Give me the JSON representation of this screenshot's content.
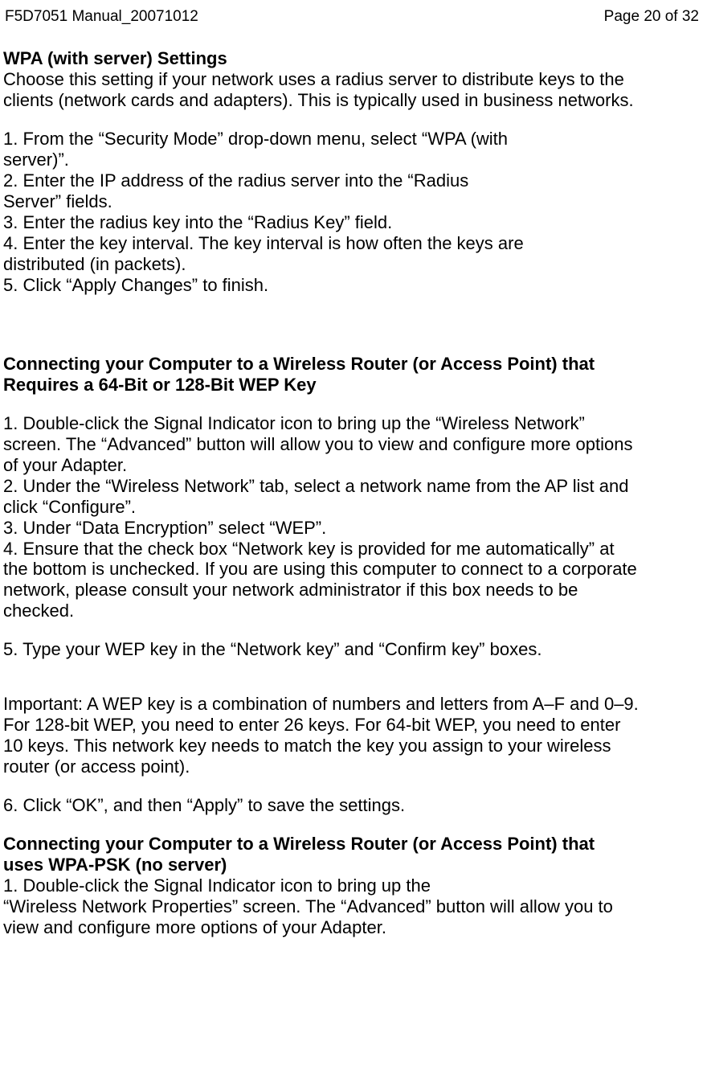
{
  "header": {
    "left": "F5D7051 Manual_20071012",
    "right": "Page 20 of 32"
  },
  "section1": {
    "title": "WPA (with server) Settings",
    "intro_l1": "Choose this setting if your network uses a radius server to distribute keys to the",
    "intro_l2": "clients (network cards and adapters). This is typically used in business networks.",
    "s1_l1": "1. From the “Security Mode” drop-down menu, select “WPA (with",
    "s1_l2": "server)”.",
    "s2_l1": "2. Enter the IP address of the radius server into the “Radius",
    "s2_l2": "Server” fields.",
    "s3": "3. Enter the radius key into the “Radius Key” field.",
    "s4_l1": "4. Enter the key interval. The key interval is how often the keys are",
    "s4_l2": "distributed (in packets).",
    "s5": "5. Click “Apply Changes” to finish."
  },
  "section2": {
    "title_l1": "Connecting your Computer to a Wireless Router (or Access Point) that",
    "title_l2": "Requires a 64-Bit or 128-Bit WEP Key",
    "s1_l1": "1. Double-click the Signal Indicator icon to bring up the “Wireless Network”",
    "s1_l2": "screen. The “Advanced” button will allow you to view and configure more options",
    "s1_l3": "of your Adapter.",
    "s2_l1": "2. Under the “Wireless Network” tab, select a network name from the AP list and",
    "s2_l2": "click “Configure”.",
    "s3": "3. Under “Data Encryption” select “WEP”.",
    "s4_l1": "4. Ensure that the check box “Network key is provided for me automatically” at",
    "s4_l2": "the bottom is unchecked. If you are using this computer to connect to a corporate",
    "s4_l3": "network, please consult your network administrator if this box needs to be",
    "s4_l4": "checked.",
    "s5": "5. Type your WEP key in the “Network key” and “Confirm key” boxes.",
    "imp_l1": "Important: A WEP key is a combination of numbers and letters from A–F and 0–9.",
    "imp_l2": "For 128-bit WEP, you need to enter 26 keys. For 64-bit WEP, you need to enter",
    "imp_l3": "10 keys. This network key needs to match the key you assign to your wireless",
    "imp_l4": "router (or access point).",
    "s6": "6. Click “OK”, and then “Apply” to save the settings."
  },
  "section3": {
    "title_l1": "Connecting your Computer to a Wireless Router (or Access Point) that",
    "title_l2": "uses WPA-PSK (no server)",
    "s1_l1": "1. Double-click the Signal Indicator icon to bring up the",
    "s1_l2": "“Wireless Network Properties” screen. The “Advanced” button will allow you to",
    "s1_l3": "view and configure more options of your Adapter."
  }
}
